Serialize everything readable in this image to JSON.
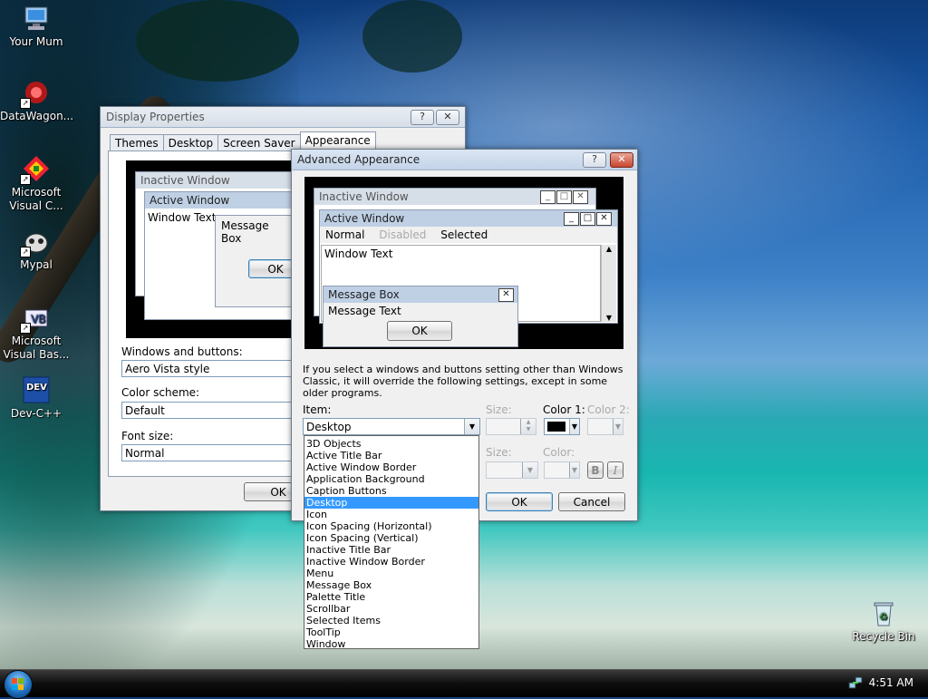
{
  "desktop": {
    "icons": [
      {
        "label": "Your Mum",
        "icon": "computer-icon"
      },
      {
        "label": "DataWagon...",
        "icon": "datawagon-icon"
      },
      {
        "label": "Microsoft Visual C...",
        "icon": "visual-c-icon"
      },
      {
        "label": "Mypal",
        "icon": "mypal-icon"
      },
      {
        "label": "Microsoft Visual Bas...",
        "icon": "visual-basic-icon"
      },
      {
        "label": "Dev-C++",
        "icon": "devcpp-icon"
      },
      {
        "label": "Recycle Bin",
        "icon": "recycle-bin-icon"
      }
    ]
  },
  "display_properties": {
    "title": "Display Properties",
    "tabs": [
      "Themes",
      "Desktop",
      "Screen Saver",
      "Appearance"
    ],
    "active_tab": "Appearance",
    "preview": {
      "inactive_window": "Inactive Window",
      "active_window": "Active Window",
      "window_text": "Window Text",
      "message_box": "Message Box",
      "ok": "OK"
    },
    "windows_buttons_label": "Windows and buttons:",
    "windows_buttons_value": "Aero Vista style",
    "color_scheme_label": "Color scheme:",
    "color_scheme_value": "Default",
    "font_size_label": "Font size:",
    "font_size_value": "Normal",
    "ok_label": "OK"
  },
  "advanced_appearance": {
    "title": "Advanced Appearance",
    "preview": {
      "inactive_window": "Inactive Window",
      "active_window": "Active Window",
      "menu_normal": "Normal",
      "menu_disabled": "Disabled",
      "menu_selected": "Selected",
      "window_text": "Window Text",
      "message_box": "Message Box",
      "message_text": "Message Text",
      "ok": "OK"
    },
    "notice": "If you select a windows and buttons setting other than Windows Classic, it will override the following settings, except in some older programs.",
    "item_label": "Item:",
    "item_value": "Desktop",
    "size_label": "Size:",
    "color1_label": "Color 1:",
    "color2_label": "Color 2:",
    "font_size_label": "Size:",
    "font_color_label": "Color:",
    "bold_label": "B",
    "italic_label": "I",
    "ok_label": "OK",
    "cancel_label": "Cancel",
    "color1_value": "#000000",
    "item_options": [
      "3D Objects",
      "Active Title Bar",
      "Active Window Border",
      "Application Background",
      "Caption Buttons",
      "Desktop",
      "Icon",
      "Icon Spacing (Horizontal)",
      "Icon Spacing (Vertical)",
      "Inactive Title Bar",
      "Inactive Window Border",
      "Menu",
      "Message Box",
      "Palette Title",
      "Scrollbar",
      "Selected Items",
      "ToolTip",
      "Window"
    ],
    "selected_option": "Desktop"
  },
  "taskbar": {
    "clock": "4:51 AM"
  },
  "colors": {
    "selection": "#3399ff",
    "close_button": "#c8452f"
  }
}
